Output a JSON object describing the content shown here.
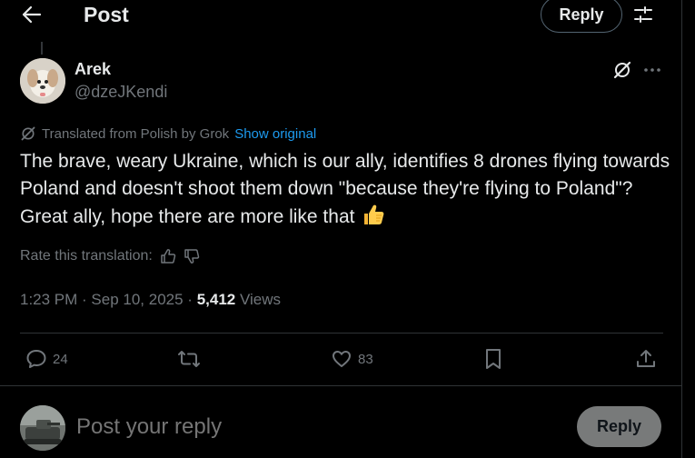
{
  "header": {
    "title": "Post",
    "reply_label": "Reply"
  },
  "author": {
    "name": "Arek",
    "handle": "@dzeJKendi"
  },
  "translation": {
    "label": "Translated from Polish by Grok",
    "show_original": "Show original"
  },
  "post": {
    "text": "The brave, weary Ukraine, which is our ally, identifies 8 drones flying towards Poland and doesn't shoot them down \"because they're flying to Poland\"? Great ally, hope there are more like that"
  },
  "rate": {
    "label": "Rate this translation:"
  },
  "meta": {
    "time": "1:23 PM",
    "sep1": " · ",
    "date": "Sep 10, 2025",
    "sep2": " · ",
    "views": "5,412",
    "views_label": " Views"
  },
  "actions": {
    "replies": "24",
    "likes": "83"
  },
  "composer": {
    "placeholder": "Post your reply",
    "reply_label": "Reply"
  },
  "icons": {
    "back": "arrow-left-icon",
    "tune": "tune-icon",
    "grok": "grok-icon",
    "more": "more-horizontal-icon",
    "reply": "reply-icon",
    "repost": "repost-icon",
    "like": "heart-icon",
    "bookmark": "bookmark-icon",
    "share": "share-icon",
    "thumbs_up": "thumbs-up-icon",
    "thumbs_down": "thumbs-down-icon"
  },
  "colors": {
    "background": "#000000",
    "text": "#e7e9ea",
    "secondary": "#71767b",
    "link": "#1d9bf0",
    "border": "#2f3336",
    "reply_button": "#787a7a"
  }
}
